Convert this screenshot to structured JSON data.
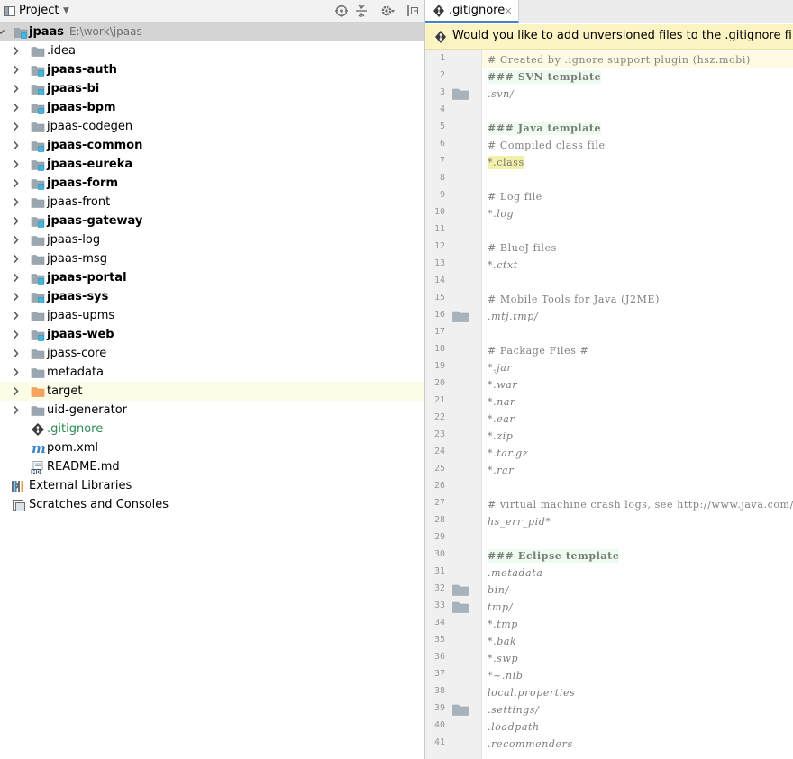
{
  "project": {
    "title": "Project",
    "dropdown": "▼",
    "icons": [
      "project-view-icon",
      "locate-icon",
      "collapse-icon",
      "settings-icon",
      "hide-icon"
    ]
  },
  "tree": [
    {
      "indent": 0,
      "arrow": "down",
      "icon": "module-folder",
      "label": "jpaas",
      "path": "E:\\work\\jpaas",
      "bold": true,
      "selected": true
    },
    {
      "indent": 1,
      "arrow": "right",
      "icon": "folder",
      "label": ".idea"
    },
    {
      "indent": 1,
      "arrow": "right",
      "icon": "module-folder",
      "label": "jpaas-auth",
      "bold": true
    },
    {
      "indent": 1,
      "arrow": "right",
      "icon": "module-folder",
      "label": "jpaas-bi",
      "bold": true
    },
    {
      "indent": 1,
      "arrow": "right",
      "icon": "module-folder",
      "label": "jpaas-bpm",
      "bold": true
    },
    {
      "indent": 1,
      "arrow": "right",
      "icon": "folder",
      "label": "jpaas-codegen"
    },
    {
      "indent": 1,
      "arrow": "right",
      "icon": "module-folder",
      "label": "jpaas-common",
      "bold": true
    },
    {
      "indent": 1,
      "arrow": "right",
      "icon": "module-folder",
      "label": "jpaas-eureka",
      "bold": true
    },
    {
      "indent": 1,
      "arrow": "right",
      "icon": "module-folder",
      "label": "jpaas-form",
      "bold": true
    },
    {
      "indent": 1,
      "arrow": "right",
      "icon": "folder",
      "label": "jpaas-front"
    },
    {
      "indent": 1,
      "arrow": "right",
      "icon": "module-folder",
      "label": "jpaas-gateway",
      "bold": true
    },
    {
      "indent": 1,
      "arrow": "right",
      "icon": "folder",
      "label": "jpaas-log"
    },
    {
      "indent": 1,
      "arrow": "right",
      "icon": "folder",
      "label": "jpaas-msg"
    },
    {
      "indent": 1,
      "arrow": "right",
      "icon": "module-folder",
      "label": "jpaas-portal",
      "bold": true
    },
    {
      "indent": 1,
      "arrow": "right",
      "icon": "module-folder",
      "label": "jpaas-sys",
      "bold": true
    },
    {
      "indent": 1,
      "arrow": "right",
      "icon": "folder",
      "label": "jpaas-upms"
    },
    {
      "indent": 1,
      "arrow": "right",
      "icon": "module-folder",
      "label": "jpaas-web",
      "bold": true
    },
    {
      "indent": 1,
      "arrow": "right",
      "icon": "folder",
      "label": "jpass-core"
    },
    {
      "indent": 1,
      "arrow": "right",
      "icon": "folder",
      "label": "metadata"
    },
    {
      "indent": 1,
      "arrow": "right",
      "icon": "excluded-folder",
      "label": "target",
      "highlight": true
    },
    {
      "indent": 1,
      "arrow": "right",
      "icon": "folder",
      "label": "uid-generator"
    },
    {
      "indent": 1,
      "arrow": "none",
      "icon": "gitignore-file",
      "label": ".gitignore",
      "green": true
    },
    {
      "indent": 1,
      "arrow": "none",
      "icon": "maven-file",
      "label": "pom.xml"
    },
    {
      "indent": 1,
      "arrow": "none",
      "icon": "markdown-file",
      "label": "README.md"
    },
    {
      "indent": 0,
      "arrow": "right",
      "icon": "libraries",
      "label": "External Libraries"
    },
    {
      "indent": 0,
      "arrow": "none",
      "icon": "scratches",
      "label": "Scratches and Consoles"
    }
  ],
  "editor": {
    "tab": {
      "label": ".gitignore",
      "close": "×"
    },
    "banner": "Would you like to add unversioned files to the .gitignore file?",
    "colors": {
      "accent": "#4083c9",
      "banner_bg": "#fcf4c2",
      "header_bg": "#edfcee",
      "entry_hl": "#f2f1a9"
    },
    "lines": [
      {
        "n": "1",
        "text": "# Created by .ignore support plugin (hsz.mobi)",
        "kind": "comment",
        "current": true
      },
      {
        "n": "2",
        "text": "### SVN template",
        "kind": "header"
      },
      {
        "n": "3",
        "text": ".svn/",
        "kind": "entry",
        "folder": true
      },
      {
        "n": "4",
        "text": "",
        "kind": "blank"
      },
      {
        "n": "5",
        "text": "### Java template",
        "kind": "header"
      },
      {
        "n": "6",
        "text": "# Compiled class file",
        "kind": "comment"
      },
      {
        "n": "7",
        "text": "*.class",
        "kind": "entry-hl"
      },
      {
        "n": "8",
        "text": "",
        "kind": "blank"
      },
      {
        "n": "9",
        "text": "# Log file",
        "kind": "comment"
      },
      {
        "n": "10",
        "text": "*.log",
        "kind": "entry"
      },
      {
        "n": "11",
        "text": "",
        "kind": "blank"
      },
      {
        "n": "12",
        "text": "# BlueJ files",
        "kind": "comment"
      },
      {
        "n": "13",
        "text": "*.ctxt",
        "kind": "entry"
      },
      {
        "n": "14",
        "text": "",
        "kind": "blank"
      },
      {
        "n": "15",
        "text": "# Mobile Tools for Java (J2ME)",
        "kind": "comment"
      },
      {
        "n": "16",
        "text": ".mtj.tmp/",
        "kind": "entry",
        "folder": true
      },
      {
        "n": "17",
        "text": "",
        "kind": "blank"
      },
      {
        "n": "18",
        "text": "# Package Files #",
        "kind": "comment"
      },
      {
        "n": "19",
        "text": "*.jar",
        "kind": "entry"
      },
      {
        "n": "20",
        "text": "*.war",
        "kind": "entry"
      },
      {
        "n": "21",
        "text": "*.nar",
        "kind": "entry"
      },
      {
        "n": "22",
        "text": "*.ear",
        "kind": "entry"
      },
      {
        "n": "23",
        "text": "*.zip",
        "kind": "entry"
      },
      {
        "n": "24",
        "text": "*.tar.gz",
        "kind": "entry"
      },
      {
        "n": "25",
        "text": "*.rar",
        "kind": "entry"
      },
      {
        "n": "26",
        "text": "",
        "kind": "blank"
      },
      {
        "n": "27",
        "text": "# virtual machine crash logs, see http://www.java.com/en/",
        "kind": "comment"
      },
      {
        "n": "28",
        "text": "hs_err_pid*",
        "kind": "entry"
      },
      {
        "n": "29",
        "text": "",
        "kind": "blank"
      },
      {
        "n": "30",
        "text": "### Eclipse template",
        "kind": "header"
      },
      {
        "n": "31",
        "text": ".metadata",
        "kind": "entry"
      },
      {
        "n": "32",
        "text": "bin/",
        "kind": "entry",
        "folder": true
      },
      {
        "n": "33",
        "text": "tmp/",
        "kind": "entry",
        "folder": true
      },
      {
        "n": "34",
        "text": "*.tmp",
        "kind": "entry"
      },
      {
        "n": "35",
        "text": "*.bak",
        "kind": "entry"
      },
      {
        "n": "36",
        "text": "*.swp",
        "kind": "entry"
      },
      {
        "n": "37",
        "text": "*~.nib",
        "kind": "entry"
      },
      {
        "n": "38",
        "text": "local.properties",
        "kind": "entry"
      },
      {
        "n": "39",
        "text": ".settings/",
        "kind": "entry",
        "folder": true
      },
      {
        "n": "40",
        "text": ".loadpath",
        "kind": "entry"
      },
      {
        "n": "41",
        "text": ".recommenders",
        "kind": "entry"
      }
    ]
  }
}
